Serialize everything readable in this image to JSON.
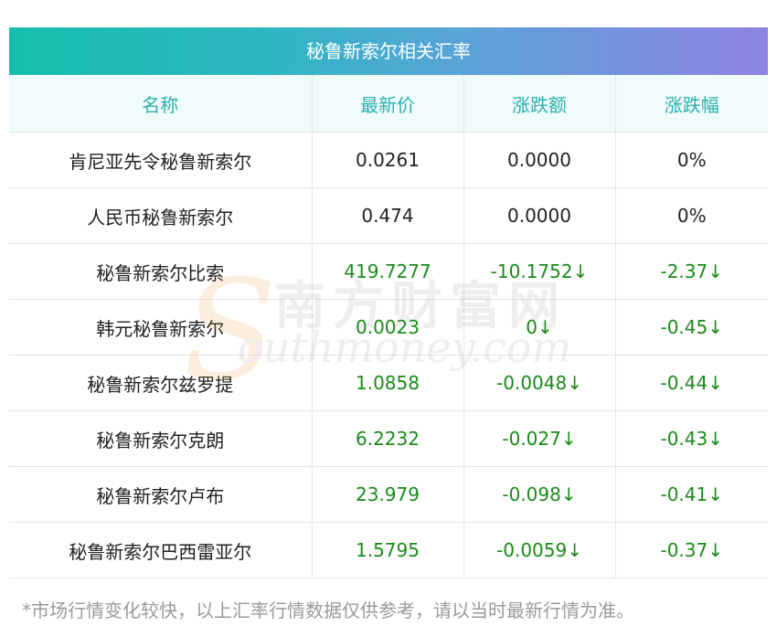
{
  "table": {
    "title": "秘鲁新索尔相关汇率",
    "headers": [
      "名称",
      "最新价",
      "涨跌额",
      "涨跌幅"
    ],
    "rows": [
      {
        "name": "肯尼亚先令秘鲁新索尔",
        "price": "0.0261",
        "change": "0.0000",
        "pct": "0%",
        "trend": "flat"
      },
      {
        "name": "人民币秘鲁新索尔",
        "price": "0.474",
        "change": "0.0000",
        "pct": "0%",
        "trend": "flat"
      },
      {
        "name": "秘鲁新索尔比索",
        "price": "419.7277",
        "change": "-10.1752↓",
        "pct": "-2.37↓",
        "trend": "down"
      },
      {
        "name": "韩元秘鲁新索尔",
        "price": "0.0023",
        "change": "0↓",
        "pct": "-0.45↓",
        "trend": "down"
      },
      {
        "name": "秘鲁新索尔兹罗提",
        "price": "1.0858",
        "change": "-0.0048↓",
        "pct": "-0.44↓",
        "trend": "down"
      },
      {
        "name": "秘鲁新索尔克朗",
        "price": "6.2232",
        "change": "-0.027↓",
        "pct": "-0.43↓",
        "trend": "down"
      },
      {
        "name": "秘鲁新索尔卢布",
        "price": "23.979",
        "change": "-0.098↓",
        "pct": "-0.41↓",
        "trend": "down"
      },
      {
        "name": "秘鲁新索尔巴西雷亚尔",
        "price": "1.5795",
        "change": "-0.0059↓",
        "pct": "-0.37↓",
        "trend": "down"
      }
    ],
    "note": "*市场行情变化较快，以上汇率行情数据仅供参考，请以当时最新行情为准。"
  },
  "watermark": {
    "cn": "南方财富网",
    "en": "outhmoney.com",
    "s": "S"
  },
  "colors": {
    "header_text": "#2bb0ae",
    "down": "#1a8a1a",
    "title_gradient_start": "#16bfad",
    "title_gradient_end": "#8d82e0"
  }
}
